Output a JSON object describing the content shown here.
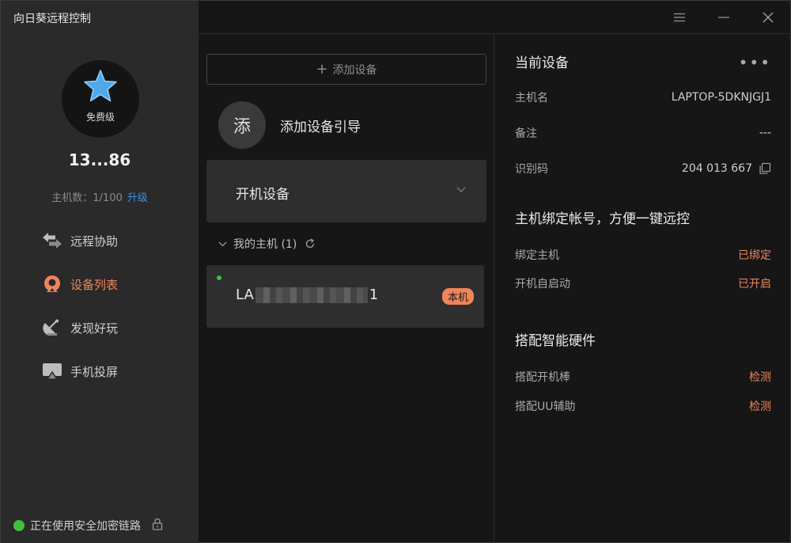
{
  "app": {
    "title": "向日葵远程控制"
  },
  "user": {
    "tier": "免费级",
    "id": "13...86",
    "host_count_label": "主机数：",
    "host_count": "1/100",
    "upgrade": "升级"
  },
  "nav": [
    {
      "label": "远程协助",
      "icon": "remote-assist-icon"
    },
    {
      "label": "设备列表",
      "icon": "device-list-icon",
      "active": true
    },
    {
      "label": "发现好玩",
      "icon": "discover-icon"
    },
    {
      "label": "手机投屏",
      "icon": "screen-cast-icon"
    }
  ],
  "status": {
    "text": "正在使用安全加密链路"
  },
  "middle": {
    "add_device": "添加设备",
    "guide": {
      "avatar_char": "添",
      "label": "添加设备引导"
    },
    "boot_device": "开机设备",
    "my_hosts": {
      "label": "我的主机 (1)"
    },
    "host": {
      "name_prefix": "LA",
      "name_suffix": "1",
      "badge": "本机"
    }
  },
  "right": {
    "current": {
      "title": "当前设备",
      "hostname_label": "主机名",
      "hostname": "LAPTOP-5DKNJGJ1",
      "note_label": "备注",
      "note": "---",
      "code_label": "识别码",
      "code": "204 013 667"
    },
    "bind": {
      "title": "主机绑定帐号，方便一键远控",
      "bind_label": "绑定主机",
      "bind_value": "已绑定",
      "autostart_label": "开机自启动",
      "autostart_value": "已开启"
    },
    "hardware": {
      "title": "搭配智能硬件",
      "stick_label": "搭配开机棒",
      "stick_value": "检测",
      "uu_label": "搭配UU辅助",
      "uu_value": "检测"
    }
  },
  "colors": {
    "accent": "#f0845a",
    "link": "#3d8fe0",
    "online": "#3ec13e"
  }
}
